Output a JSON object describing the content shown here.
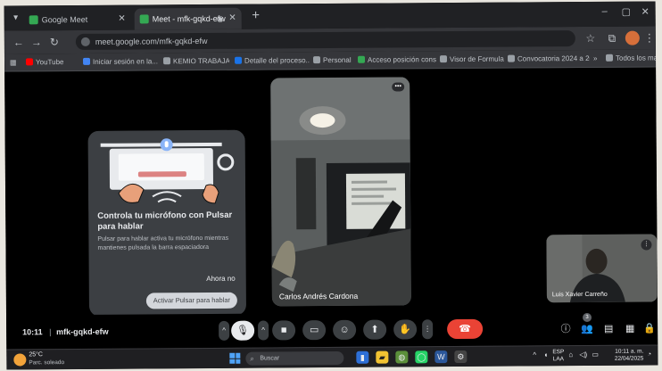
{
  "browser": {
    "tabs": [
      {
        "title": "Google Meet"
      },
      {
        "title": "Meet - mfk-gqkd-efw"
      }
    ],
    "url": "meet.google.com/mfk-gqkd-efw",
    "bookmarks": [
      {
        "label": "YouTube",
        "color": "#ff0000"
      },
      {
        "label": "Iniciar sesión en la...",
        "color": "#4285f4"
      },
      {
        "label": "KEMIO TRABAJADER...",
        "color": "#9aa0a6"
      },
      {
        "label": "Detalle del proceso...",
        "color": "#1a73e8"
      },
      {
        "label": "Personal",
        "color": "#9aa0a6"
      },
      {
        "label": "Acceso posición cons...",
        "color": "#34a853"
      },
      {
        "label": "Visor de Formularios",
        "color": "#9aa0a6"
      },
      {
        "label": "Convocatoria 2024 a 2025...",
        "color": "#9aa0a6"
      },
      {
        "label": "Todos los marcadores",
        "color": "#9aa0a6"
      }
    ]
  },
  "tip_card": {
    "title": "Controla tu micrófono con Pulsar para hablar",
    "body": "Pulsar para hablar activa tu micrófono mientras mantienes pulsada la barra espaciadora",
    "dismiss_label": "Ahora no",
    "cta_label": "Activar Pulsar para hablar"
  },
  "participants": {
    "main_name": "Carlos Andrés Cardona",
    "self_name": "Luis Xavier Carreño"
  },
  "meeting": {
    "time": "10:11",
    "separator": "|",
    "code": "mfk-gqkd-efw",
    "participant_count": "3"
  },
  "taskbar": {
    "weather_temp": "25°C",
    "weather_desc": "Parc. soleado",
    "search_placeholder": "Buscar",
    "lang_top": "ESP",
    "lang_bottom": "LAA",
    "clock_time": "10:11 a. m.",
    "clock_date": "22/04/2025"
  },
  "colors": {
    "meet_background": "#000000",
    "hangup": "#ea4335",
    "card_background": "#3c3f43"
  }
}
